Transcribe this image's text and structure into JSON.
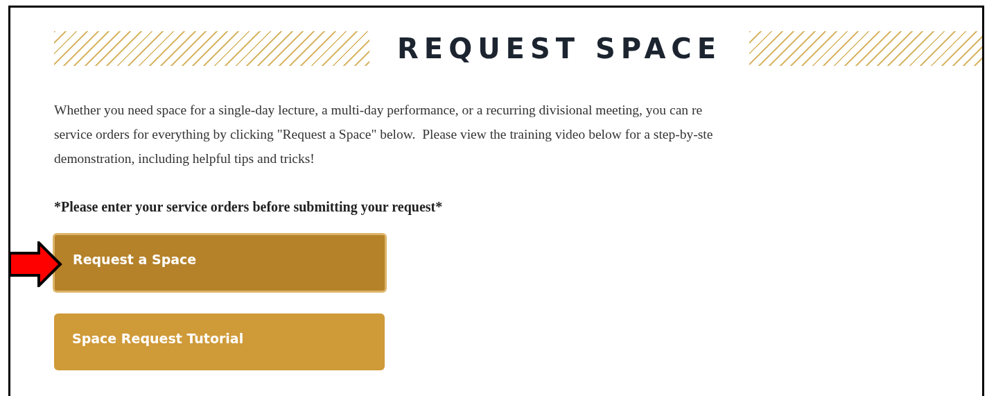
{
  "heading": "REQUEST SPACE",
  "intro_lines": [
    "Whether you need space for a single-day lecture, a multi-day performance, or a recurring divisional meeting, you can re",
    "service orders for everything by clicking \"Request a Space\" below.  Please view the training video below for a step-by-ste",
    "demonstration, including helpful tips and tricks!"
  ],
  "notice": "*Please enter your service orders before submitting your request*",
  "buttons": [
    {
      "label": "Request a Space",
      "highlighted": true
    },
    {
      "label": "Space Request Tutorial",
      "highlighted": false
    }
  ]
}
